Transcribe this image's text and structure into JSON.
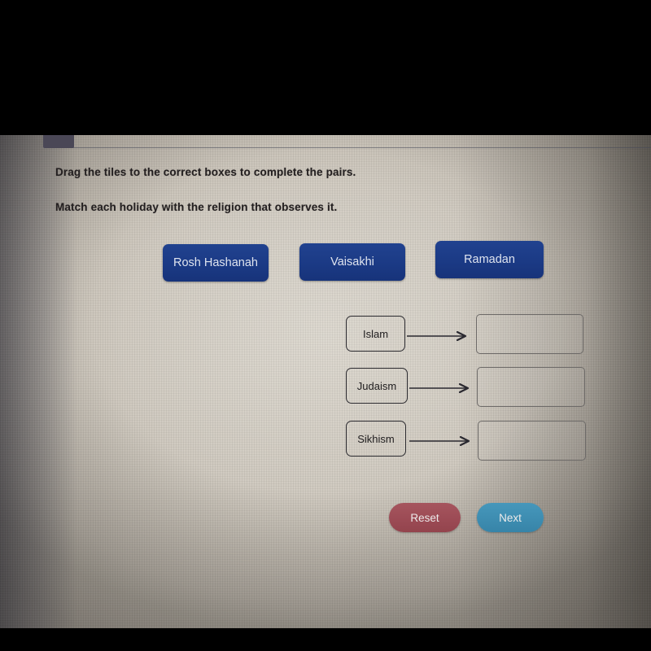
{
  "activity": {
    "instruction_primary": "Drag the tiles to the correct boxes to complete the pairs.",
    "instruction_secondary": "Match each holiday with the religion that observes it.",
    "tile_color": "#1b3a85",
    "tile_text_color": "#dfe4ef"
  },
  "tiles": [
    {
      "label": "Rosh Hashanah"
    },
    {
      "label": "Vaisakhi"
    },
    {
      "label": "Ramadan"
    }
  ],
  "matches": [
    {
      "religion": "Islam",
      "answer": ""
    },
    {
      "religion": "Judaism",
      "answer": ""
    },
    {
      "religion": "Sikhism",
      "answer": ""
    }
  ],
  "buttons": {
    "reset_label": "Reset",
    "reset_color": "#9b4a54",
    "next_label": "Next",
    "next_color": "#3d8cb0"
  }
}
